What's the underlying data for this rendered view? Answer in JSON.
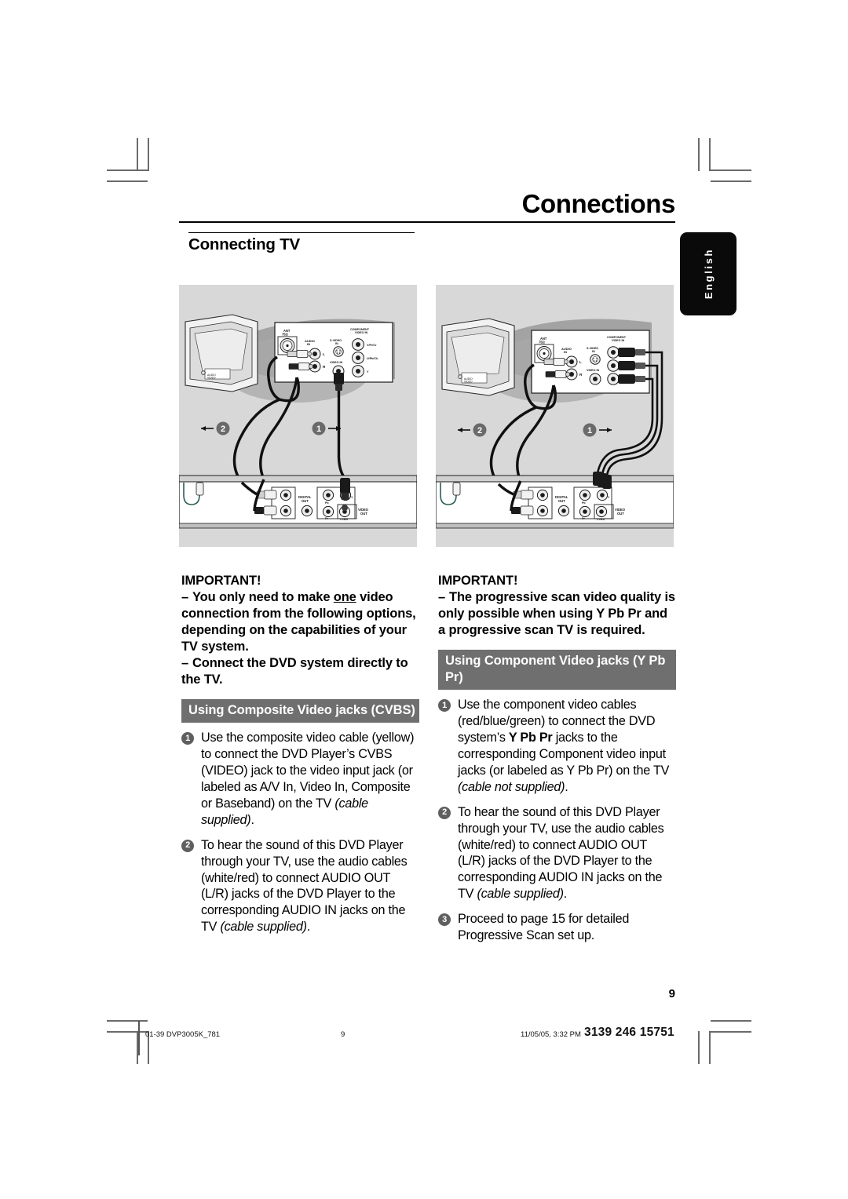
{
  "header": {
    "chapter_title": "Connections",
    "section_title": "Connecting TV"
  },
  "language_tab": {
    "label": "English"
  },
  "figures": {
    "left": {
      "name": "composite-video-connection-diagram",
      "tv_panel_labels": [
        "ANT",
        "AUDIO IN",
        "L",
        "R",
        "S-VIDEO IN",
        "VIDEO IN",
        "COMPONENT VIDEO IN",
        "V/Pr/Cr",
        "U/Pb/Cb",
        "Y"
      ],
      "dvd_panel_labels": [
        "DIGITAL OUT",
        "VIDEO OUT",
        "CVBS",
        "Pb",
        "Pr",
        "Y"
      ],
      "callouts": [
        "1",
        "2"
      ]
    },
    "right": {
      "name": "component-video-connection-diagram",
      "tv_panel_labels": [
        "ANT",
        "AUDIO IN",
        "L",
        "R",
        "S-VIDEO IN",
        "VIDEO IN",
        "COMPONENT VIDEO IN"
      ],
      "dvd_panel_labels": [
        "DIGITAL OUT",
        "VIDEO OUT",
        "CVBS",
        "Pb",
        "Pr",
        "Y"
      ],
      "callouts": [
        "1",
        "2"
      ]
    }
  },
  "left_column": {
    "important_heading": "IMPORTANT!",
    "important_items": [
      {
        "dash": "–",
        "pre": "You only need to make ",
        "underline": "one",
        "post": " video connection from the following options, depending on the capabilities of your TV system."
      },
      {
        "dash": "–",
        "pre": "Connect the DVD system directly to the TV.",
        "underline": "",
        "post": ""
      }
    ],
    "band_title": "Using Composite Video jacks (CVBS)",
    "steps": [
      {
        "num": "1",
        "text": "Use the composite video cable (yellow) to connect the DVD Player’s CVBS (VIDEO) jack to the video input jack (or labeled as A/V In, Video In, Composite or Baseband) on the TV ",
        "italic": "(cable supplied)",
        "tail": "."
      },
      {
        "num": "2",
        "text": "To hear the sound of this DVD Player through your TV, use the audio cables (white/red) to connect AUDIO OUT (L/R) jacks of the DVD Player to the corresponding AUDIO IN jacks on the TV ",
        "italic": "(cable supplied)",
        "tail": "."
      }
    ]
  },
  "right_column": {
    "important_heading": "IMPORTANT!",
    "important_items": [
      {
        "dash": "–",
        "pre": "The progressive scan video quality is only possible when using Y Pb Pr and a progressive scan TV is required.",
        "underline": "",
        "post": ""
      }
    ],
    "band_title": "Using Component Video jacks (Y Pb Pr)",
    "steps": [
      {
        "num": "1",
        "lead": "Use the component video cables (red/blue/green) to connect the DVD system’s ",
        "bold": "Y Pb Pr",
        "text": " jacks to the corresponding Component video input jacks (or labeled as Y Pb Pr) on the TV ",
        "italic": "(cable not supplied)",
        "tail": "."
      },
      {
        "num": "2",
        "lead": "",
        "bold": "",
        "text": "To hear the sound of this DVD Player through your TV, use the audio cables (white/red) to connect AUDIO OUT (L/R) jacks of the DVD Player to the corresponding AUDIO IN jacks on the TV ",
        "italic": "(cable supplied)",
        "tail": "."
      },
      {
        "num": "3",
        "lead": "",
        "bold": "",
        "text": "Proceed to page 15 for detailed Progressive Scan set up.",
        "italic": "",
        "tail": ""
      }
    ]
  },
  "page_number": "9",
  "footer": {
    "file_name": "01-39 DVP3005K_781",
    "page": "9",
    "timestamp": "11/05/05, 3:32 PM",
    "doc_code": "3139 246 15751"
  },
  "colors": {
    "band_gray": "#6f6f6f",
    "figure_background": "#d8d8d8",
    "bullet_gray": "#5f5f5f",
    "tab_black": "#0a0a0a"
  }
}
